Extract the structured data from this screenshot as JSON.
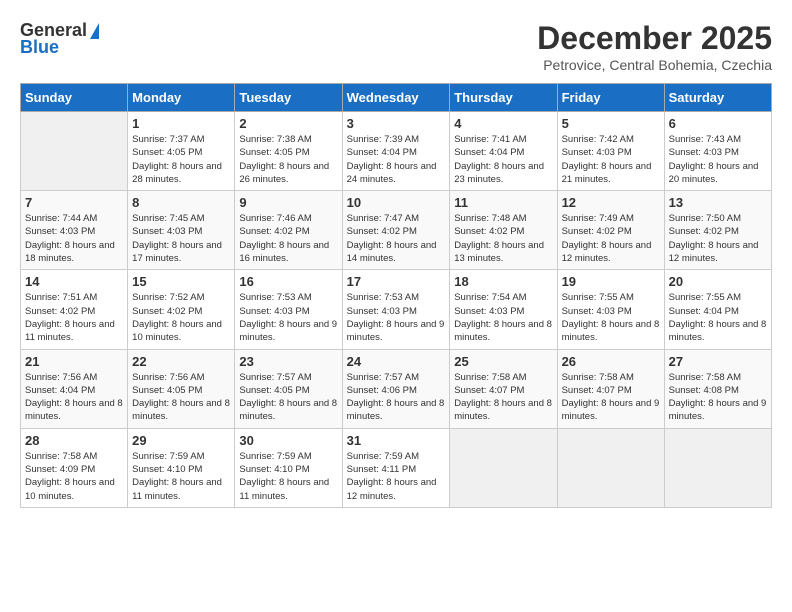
{
  "header": {
    "logo_general": "General",
    "logo_blue": "Blue",
    "month": "December 2025",
    "location": "Petrovice, Central Bohemia, Czechia"
  },
  "days_of_week": [
    "Sunday",
    "Monday",
    "Tuesday",
    "Wednesday",
    "Thursday",
    "Friday",
    "Saturday"
  ],
  "weeks": [
    [
      {
        "num": "",
        "sunrise": "",
        "sunset": "",
        "daylight": "",
        "empty": true
      },
      {
        "num": "1",
        "sunrise": "Sunrise: 7:37 AM",
        "sunset": "Sunset: 4:05 PM",
        "daylight": "Daylight: 8 hours and 28 minutes."
      },
      {
        "num": "2",
        "sunrise": "Sunrise: 7:38 AM",
        "sunset": "Sunset: 4:05 PM",
        "daylight": "Daylight: 8 hours and 26 minutes."
      },
      {
        "num": "3",
        "sunrise": "Sunrise: 7:39 AM",
        "sunset": "Sunset: 4:04 PM",
        "daylight": "Daylight: 8 hours and 24 minutes."
      },
      {
        "num": "4",
        "sunrise": "Sunrise: 7:41 AM",
        "sunset": "Sunset: 4:04 PM",
        "daylight": "Daylight: 8 hours and 23 minutes."
      },
      {
        "num": "5",
        "sunrise": "Sunrise: 7:42 AM",
        "sunset": "Sunset: 4:03 PM",
        "daylight": "Daylight: 8 hours and 21 minutes."
      },
      {
        "num": "6",
        "sunrise": "Sunrise: 7:43 AM",
        "sunset": "Sunset: 4:03 PM",
        "daylight": "Daylight: 8 hours and 20 minutes."
      }
    ],
    [
      {
        "num": "7",
        "sunrise": "Sunrise: 7:44 AM",
        "sunset": "Sunset: 4:03 PM",
        "daylight": "Daylight: 8 hours and 18 minutes."
      },
      {
        "num": "8",
        "sunrise": "Sunrise: 7:45 AM",
        "sunset": "Sunset: 4:03 PM",
        "daylight": "Daylight: 8 hours and 17 minutes."
      },
      {
        "num": "9",
        "sunrise": "Sunrise: 7:46 AM",
        "sunset": "Sunset: 4:02 PM",
        "daylight": "Daylight: 8 hours and 16 minutes."
      },
      {
        "num": "10",
        "sunrise": "Sunrise: 7:47 AM",
        "sunset": "Sunset: 4:02 PM",
        "daylight": "Daylight: 8 hours and 14 minutes."
      },
      {
        "num": "11",
        "sunrise": "Sunrise: 7:48 AM",
        "sunset": "Sunset: 4:02 PM",
        "daylight": "Daylight: 8 hours and 13 minutes."
      },
      {
        "num": "12",
        "sunrise": "Sunrise: 7:49 AM",
        "sunset": "Sunset: 4:02 PM",
        "daylight": "Daylight: 8 hours and 12 minutes."
      },
      {
        "num": "13",
        "sunrise": "Sunrise: 7:50 AM",
        "sunset": "Sunset: 4:02 PM",
        "daylight": "Daylight: 8 hours and 12 minutes."
      }
    ],
    [
      {
        "num": "14",
        "sunrise": "Sunrise: 7:51 AM",
        "sunset": "Sunset: 4:02 PM",
        "daylight": "Daylight: 8 hours and 11 minutes."
      },
      {
        "num": "15",
        "sunrise": "Sunrise: 7:52 AM",
        "sunset": "Sunset: 4:02 PM",
        "daylight": "Daylight: 8 hours and 10 minutes."
      },
      {
        "num": "16",
        "sunrise": "Sunrise: 7:53 AM",
        "sunset": "Sunset: 4:03 PM",
        "daylight": "Daylight: 8 hours and 9 minutes."
      },
      {
        "num": "17",
        "sunrise": "Sunrise: 7:53 AM",
        "sunset": "Sunset: 4:03 PM",
        "daylight": "Daylight: 8 hours and 9 minutes."
      },
      {
        "num": "18",
        "sunrise": "Sunrise: 7:54 AM",
        "sunset": "Sunset: 4:03 PM",
        "daylight": "Daylight: 8 hours and 8 minutes."
      },
      {
        "num": "19",
        "sunrise": "Sunrise: 7:55 AM",
        "sunset": "Sunset: 4:03 PM",
        "daylight": "Daylight: 8 hours and 8 minutes."
      },
      {
        "num": "20",
        "sunrise": "Sunrise: 7:55 AM",
        "sunset": "Sunset: 4:04 PM",
        "daylight": "Daylight: 8 hours and 8 minutes."
      }
    ],
    [
      {
        "num": "21",
        "sunrise": "Sunrise: 7:56 AM",
        "sunset": "Sunset: 4:04 PM",
        "daylight": "Daylight: 8 hours and 8 minutes."
      },
      {
        "num": "22",
        "sunrise": "Sunrise: 7:56 AM",
        "sunset": "Sunset: 4:05 PM",
        "daylight": "Daylight: 8 hours and 8 minutes."
      },
      {
        "num": "23",
        "sunrise": "Sunrise: 7:57 AM",
        "sunset": "Sunset: 4:05 PM",
        "daylight": "Daylight: 8 hours and 8 minutes."
      },
      {
        "num": "24",
        "sunrise": "Sunrise: 7:57 AM",
        "sunset": "Sunset: 4:06 PM",
        "daylight": "Daylight: 8 hours and 8 minutes."
      },
      {
        "num": "25",
        "sunrise": "Sunrise: 7:58 AM",
        "sunset": "Sunset: 4:07 PM",
        "daylight": "Daylight: 8 hours and 8 minutes."
      },
      {
        "num": "26",
        "sunrise": "Sunrise: 7:58 AM",
        "sunset": "Sunset: 4:07 PM",
        "daylight": "Daylight: 8 hours and 9 minutes."
      },
      {
        "num": "27",
        "sunrise": "Sunrise: 7:58 AM",
        "sunset": "Sunset: 4:08 PM",
        "daylight": "Daylight: 8 hours and 9 minutes."
      }
    ],
    [
      {
        "num": "28",
        "sunrise": "Sunrise: 7:58 AM",
        "sunset": "Sunset: 4:09 PM",
        "daylight": "Daylight: 8 hours and 10 minutes."
      },
      {
        "num": "29",
        "sunrise": "Sunrise: 7:59 AM",
        "sunset": "Sunset: 4:10 PM",
        "daylight": "Daylight: 8 hours and 11 minutes."
      },
      {
        "num": "30",
        "sunrise": "Sunrise: 7:59 AM",
        "sunset": "Sunset: 4:10 PM",
        "daylight": "Daylight: 8 hours and 11 minutes."
      },
      {
        "num": "31",
        "sunrise": "Sunrise: 7:59 AM",
        "sunset": "Sunset: 4:11 PM",
        "daylight": "Daylight: 8 hours and 12 minutes."
      },
      {
        "num": "",
        "sunrise": "",
        "sunset": "",
        "daylight": "",
        "empty": true
      },
      {
        "num": "",
        "sunrise": "",
        "sunset": "",
        "daylight": "",
        "empty": true
      },
      {
        "num": "",
        "sunrise": "",
        "sunset": "",
        "daylight": "",
        "empty": true
      }
    ]
  ]
}
